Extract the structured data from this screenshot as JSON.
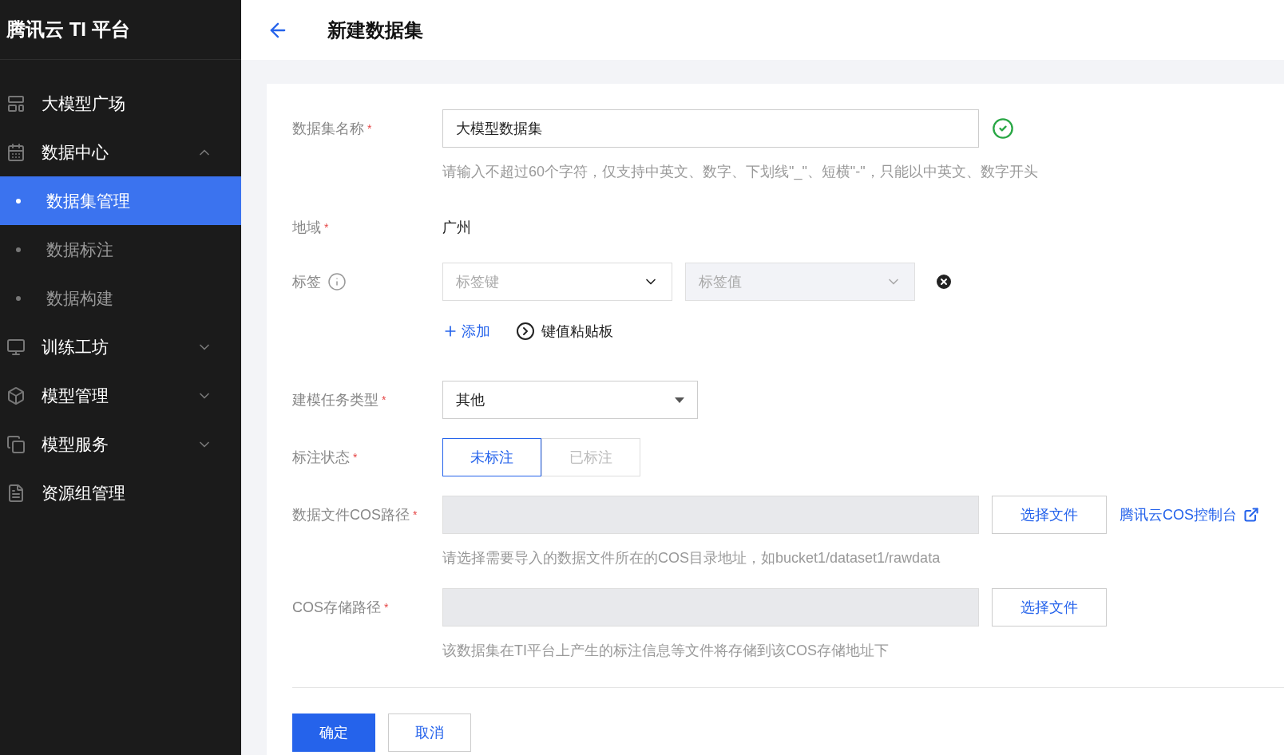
{
  "sidebar": {
    "title": "腾讯云 TI 平台",
    "items": [
      {
        "label": "大模型广场"
      },
      {
        "label": "数据中心",
        "expanded": true,
        "children": [
          {
            "label": "数据集管理",
            "selected": true
          },
          {
            "label": "数据标注",
            "selected": false
          },
          {
            "label": "数据构建",
            "selected": false
          }
        ]
      },
      {
        "label": "训练工坊",
        "expanded": false
      },
      {
        "label": "模型管理",
        "expanded": false
      },
      {
        "label": "模型服务",
        "expanded": false
      },
      {
        "label": "资源组管理"
      }
    ]
  },
  "header": {
    "title": "新建数据集"
  },
  "form": {
    "fields": [
      {
        "kind": "input",
        "label": "数据集名称",
        "required_mark": "*",
        "value": "大模型数据集",
        "valid": true,
        "hint": "请输入不超过60个字符，仅支持中英文、数字、下划线\"_\"、短横\"-\"，只能以中英文、数字开头"
      },
      {
        "kind": "static",
        "label": "地域",
        "required_mark": "*",
        "value": "广州"
      },
      {
        "kind": "tags",
        "label": "标签",
        "info": true,
        "key_placeholder": "标签键",
        "value_placeholder": "标签值",
        "add": "添加",
        "clipboard": "键值粘贴板"
      },
      {
        "kind": "select",
        "label": "建模任务类型",
        "required_mark": "*",
        "value": "其他"
      },
      {
        "kind": "segmented",
        "label": "标注状态",
        "required_mark": "*",
        "options": [
          {
            "label": "未标注",
            "selected": true
          },
          {
            "label": "已标注",
            "selected": false
          }
        ]
      },
      {
        "kind": "path",
        "label": "数据文件COS路径",
        "required_mark": "*",
        "button": "选择文件",
        "link": "腾讯云COS控制台",
        "hint": "请选择需要导入的数据文件所在的COS目录地址，如bucket1/dataset1/rawdata"
      },
      {
        "kind": "path",
        "label": "COS存储路径",
        "required_mark": "*",
        "button": "选择文件",
        "hint": "该数据集在TI平台上产生的标注信息等文件将存储到该COS存储地址下"
      }
    ],
    "buttons": [
      {
        "label": "确定",
        "primary": true
      },
      {
        "label": "取消",
        "primary": false
      }
    ]
  }
}
